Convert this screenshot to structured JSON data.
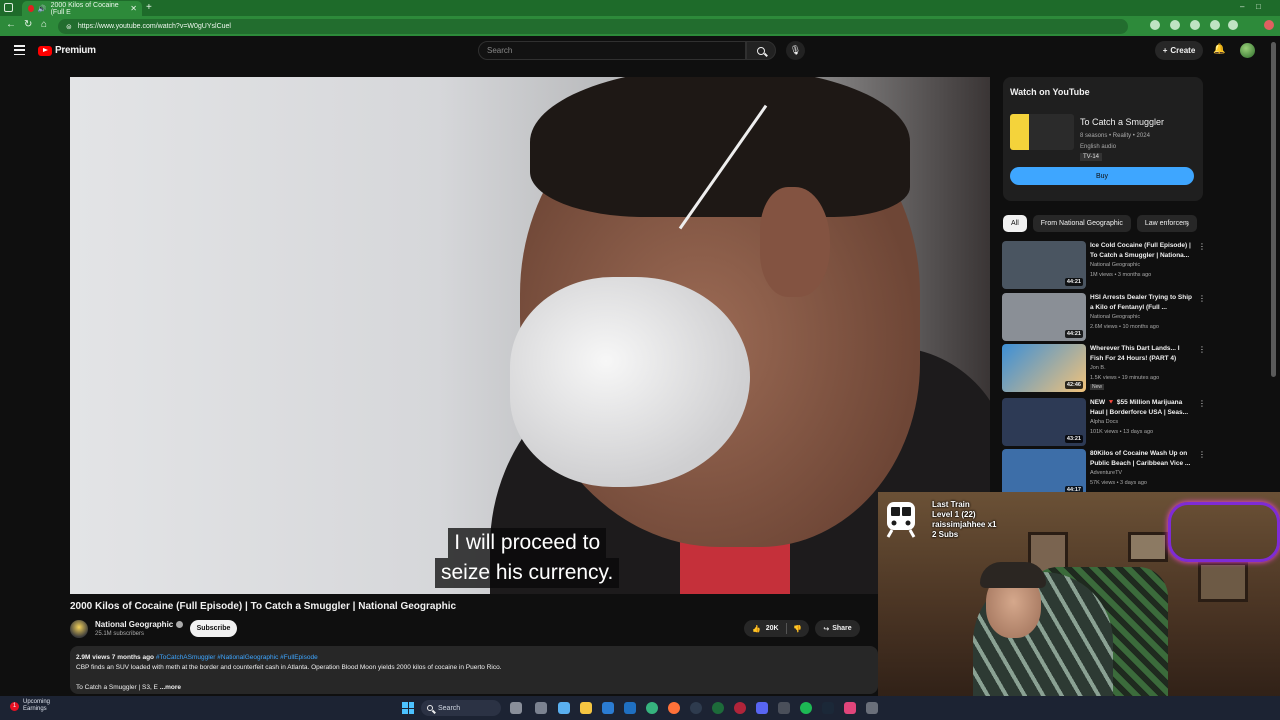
{
  "browser": {
    "tab_title": "2000 Kilos of Cocaine (Full E",
    "url": "https://www.youtube.com/watch?v=W0gUYslCuel"
  },
  "header": {
    "logo_word": "Premium",
    "search_placeholder": "Search",
    "create_label": "Create"
  },
  "player": {
    "caption_line1": "I will proceed to",
    "caption_line2": "seize his currency."
  },
  "video": {
    "title": "2000 Kilos of Cocaine (Full Episode) | To Catch a Smuggler | National Geographic",
    "channel": "National Geographic",
    "subscribers": "25.1M subscribers",
    "subscribe_label": "Subscribe",
    "likes": "20K",
    "share_label": "Share",
    "views_meta": "2.9M views  7 months ago",
    "hashtags": "#ToCatchASmuggler #NationalGeographic #FullEpisode",
    "description": "CBP finds an SUV loaded with meth at the border and counterfeit cash in Atlanta. Operation Blood Moon yields 2000 kilos of cocaine in Puerto Rico.",
    "desc_line2": "To Catch a Smuggler | S3, E",
    "more_label": "...more"
  },
  "watch_card": {
    "heading": "Watch on YouTube",
    "title": "To Catch a Smuggler",
    "meta1": "8 seasons • Reality • 2024",
    "meta2": "English audio",
    "rating": "TV-14",
    "buy_label": "Buy"
  },
  "chips": [
    "All",
    "From National Geographic",
    "Law enforcem"
  ],
  "recommendations": [
    {
      "title": "Ice Cold Cocaine (Full Episode) | To Catch a Smuggler | Nationa...",
      "channel": "National Geographic",
      "views": "1M views • 3 months ago",
      "duration": "44:21",
      "thumb": "#4a5561"
    },
    {
      "title": "HSI Arrests Dealer Trying to Ship a Kilo of Fentanyl (Full ...",
      "channel": "National Geographic",
      "views": "2.6M views • 10 months ago",
      "duration": "44:21",
      "thumb": "#8a8f96"
    },
    {
      "title": "Wherever This Dart Lands... I Fish For 24 Hours! (PART 4)",
      "channel": "Jon B.",
      "views": "1.5K views • 19 minutes ago",
      "duration": "42:46",
      "badge": "New",
      "thumb": "#3c8fd6"
    },
    {
      "title": "NEW 🔻 $55 Million Marijuana Haul | Borderforce USA | Seas...",
      "channel": "Alpha Docs",
      "views": "101K views • 13 days ago",
      "duration": "43:21",
      "thumb": "#2d3a55"
    },
    {
      "title": "80Kilos of Cocaine Wash Up on Public Beach | Caribbean Vice ...",
      "channel": "AdventureTV",
      "views": "57K views • 3 days ago",
      "duration": "44:17",
      "thumb": "#3d6ea8"
    }
  ],
  "stream_overlay": {
    "line1": "Last Train",
    "line2": "Level 1  (22)",
    "line3": "raissimjahhee x1",
    "line4": "2 Subs"
  },
  "taskbar": {
    "notif_count": "1",
    "weather_line1": "Upcoming",
    "weather_line2": "Earnings",
    "search_label": "Search"
  }
}
